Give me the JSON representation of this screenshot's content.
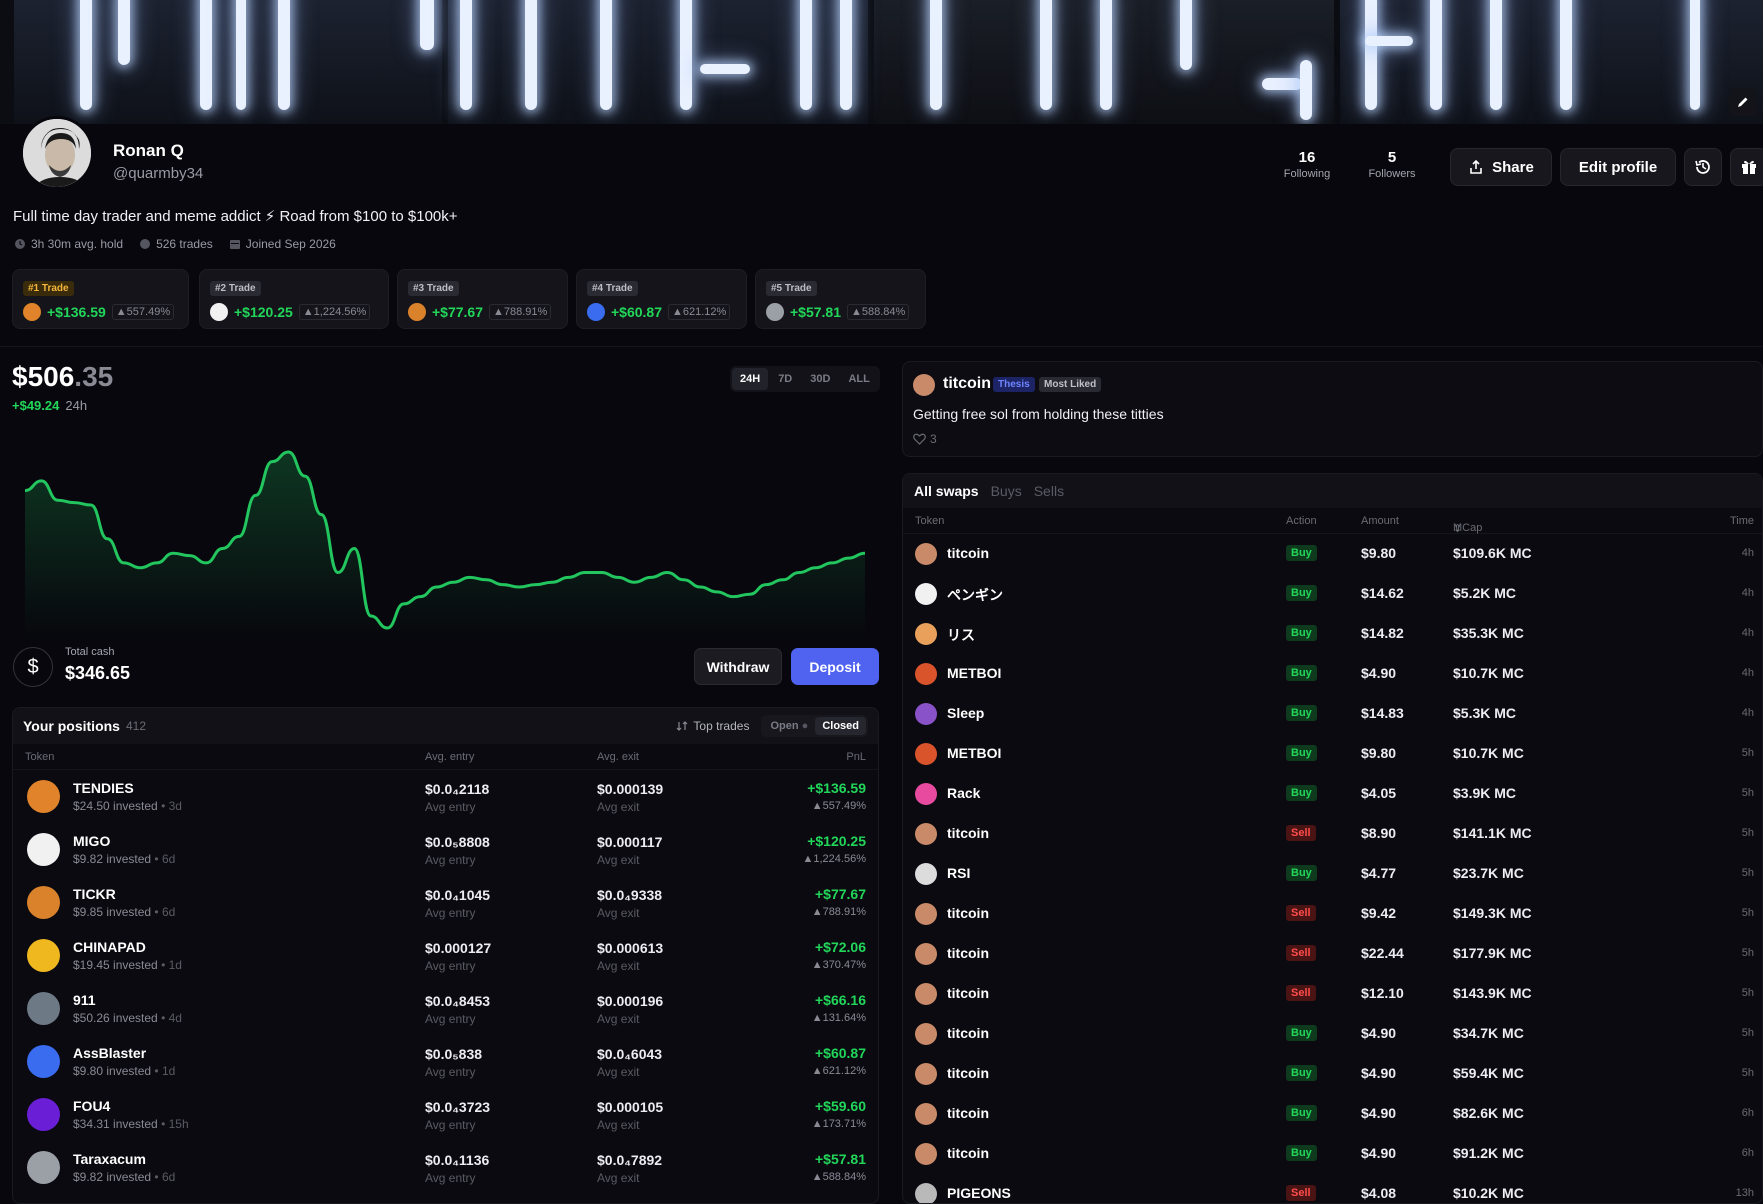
{
  "profile": {
    "name": "Ronan Q",
    "handle": "@quarmby34",
    "following_count": "16",
    "following_label": "Following",
    "followers_count": "5",
    "followers_label": "Followers",
    "share_label": "Share",
    "edit_label": "Edit profile",
    "bio": "Full time day trader and meme addict ⚡ Road from $100 to $100k+",
    "avg_hold": "3h 30m avg. hold",
    "trades": "526 trades",
    "joined": "Joined Sep 2026"
  },
  "top_trades": [
    {
      "rank": "#1 Trade",
      "value": "+$136.59",
      "pct": "▲557.49%",
      "icon_color": "#e0832a"
    },
    {
      "rank": "#2 Trade",
      "value": "+$120.25",
      "pct": "▲1,224.56%",
      "icon_color": "#f1f1f1"
    },
    {
      "rank": "#3 Trade",
      "value": "+$77.67",
      "pct": "▲788.91%",
      "icon_color": "#d9822b"
    },
    {
      "rank": "#4 Trade",
      "value": "+$60.87",
      "pct": "▲621.12%",
      "icon_color": "#3a6cf0"
    },
    {
      "rank": "#5 Trade",
      "value": "+$57.81",
      "pct": "▲588.84%",
      "icon_color": "#9aa0a6"
    }
  ],
  "balance": {
    "dollars": "$506",
    "cents": ".35",
    "change": "+$49.24",
    "period": "24h",
    "ranges": [
      "24H",
      "7D",
      "30D",
      "ALL"
    ],
    "active_range": "24H"
  },
  "chart_data": {
    "type": "area",
    "series": [
      {
        "values": [
          92,
          96,
          88,
          87,
          86,
          72,
          62,
          60,
          62,
          66,
          65,
          62,
          68,
          73,
          90,
          104,
          108,
          98,
          82,
          58,
          68,
          40,
          35,
          45,
          48,
          52,
          54,
          56,
          55,
          53,
          52,
          53,
          54,
          56,
          58,
          58,
          56,
          54,
          56,
          58,
          55,
          52,
          50,
          48,
          49,
          53,
          55,
          58,
          60,
          62,
          64,
          66
        ]
      }
    ],
    "color": "#22c55e"
  },
  "cash": {
    "label": "Total cash",
    "value": "$346.65",
    "withdraw_label": "Withdraw",
    "deposit_label": "Deposit"
  },
  "positions": {
    "title": "Your positions",
    "count": "412",
    "top_trades_label": "Top trades",
    "open_label": "Open",
    "closed_label": "Closed",
    "col_token": "Token",
    "col_entry": "Avg. entry",
    "col_exit": "Avg. exit",
    "col_pnl": "PnL",
    "sub_entry": "Avg entry",
    "sub_exit": "Avg exit",
    "rows": [
      {
        "name": "TENDIES",
        "invested": "$24.50 invested",
        "age": "• 3d",
        "entry": "$0.0₄2118",
        "exit": "$0.000139",
        "pnl": "+$136.59",
        "pct": "▲557.49%",
        "color": "#e0832a"
      },
      {
        "name": "MIGO",
        "invested": "$9.82 invested",
        "age": "• 6d",
        "entry": "$0.0₅8808",
        "exit": "$0.000117",
        "pnl": "+$120.25",
        "pct": "▲1,224.56%",
        "color": "#f1f1f1"
      },
      {
        "name": "TICKR",
        "invested": "$9.85 invested",
        "age": "• 6d",
        "entry": "$0.0₄1045",
        "exit": "$0.0₄9338",
        "pnl": "+$77.67",
        "pct": "▲788.91%",
        "color": "#d9822b"
      },
      {
        "name": "CHINAPAD",
        "invested": "$19.45 invested",
        "age": "• 1d",
        "entry": "$0.000127",
        "exit": "$0.000613",
        "pnl": "+$72.06",
        "pct": "▲370.47%",
        "color": "#f0b81f"
      },
      {
        "name": "911",
        "invested": "$50.26 invested",
        "age": "• 4d",
        "entry": "$0.0₄8453",
        "exit": "$0.000196",
        "pnl": "+$66.16",
        "pct": "▲131.64%",
        "color": "#6d7a86"
      },
      {
        "name": "AssBlaster",
        "invested": "$9.80 invested",
        "age": "• 1d",
        "entry": "$0.0₅838",
        "exit": "$0.0₄6043",
        "pnl": "+$60.87",
        "pct": "▲621.12%",
        "color": "#3a6cf0"
      },
      {
        "name": "FOU4",
        "invested": "$34.31 invested",
        "age": "• 15h",
        "entry": "$0.0₄3723",
        "exit": "$0.000105",
        "pnl": "+$59.60",
        "pct": "▲173.71%",
        "color": "#6a1fd6"
      },
      {
        "name": "Taraxacum",
        "invested": "$9.82 invested",
        "age": "• 6d",
        "entry": "$0.0₄1136",
        "exit": "$0.0₄7892",
        "pnl": "+$57.81",
        "pct": "▲588.84%",
        "color": "#9aa0a6"
      }
    ]
  },
  "thesis": {
    "token": "titcoin",
    "tag1": "Thesis",
    "tag2": "Most Liked",
    "text": "Getting free sol from holding these titties",
    "likes": "3"
  },
  "swaps": {
    "tabs": [
      "All swaps",
      "Buys",
      "Sells"
    ],
    "col_token": "Token",
    "col_action": "Action",
    "col_amount": "Amount",
    "col_mcap": "MCap",
    "col_time": "Time",
    "rows": [
      {
        "token": "titcoin",
        "action": "Buy",
        "amount": "$9.80",
        "mcap": "$109.6K MC",
        "time": "4h",
        "color": "#c98a6a"
      },
      {
        "token": "ペンギン",
        "action": "Buy",
        "amount": "$14.62",
        "mcap": "$5.2K MC",
        "time": "4h",
        "color": "#f1f1f1"
      },
      {
        "token": "リス",
        "action": "Buy",
        "amount": "$14.82",
        "mcap": "$35.3K MC",
        "time": "4h",
        "color": "#e8a05a"
      },
      {
        "token": "METBOI",
        "action": "Buy",
        "amount": "$4.90",
        "mcap": "$10.7K MC",
        "time": "4h",
        "color": "#d9542b"
      },
      {
        "token": "Sleep",
        "action": "Buy",
        "amount": "$14.83",
        "mcap": "$5.3K MC",
        "time": "4h",
        "color": "#8a52c8"
      },
      {
        "token": "METBOI",
        "action": "Buy",
        "amount": "$9.80",
        "mcap": "$10.7K MC",
        "time": "5h",
        "color": "#d9542b"
      },
      {
        "token": "Rack",
        "action": "Buy",
        "amount": "$4.05",
        "mcap": "$3.9K MC",
        "time": "5h",
        "color": "#e84aa0"
      },
      {
        "token": "titcoin",
        "action": "Sell",
        "amount": "$8.90",
        "mcap": "$141.1K MC",
        "time": "5h",
        "color": "#c98a6a"
      },
      {
        "token": "RSI",
        "action": "Buy",
        "amount": "$4.77",
        "mcap": "$23.7K MC",
        "time": "5h",
        "color": "#dcdcdc"
      },
      {
        "token": "titcoin",
        "action": "Sell",
        "amount": "$9.42",
        "mcap": "$149.3K MC",
        "time": "5h",
        "color": "#c98a6a"
      },
      {
        "token": "titcoin",
        "action": "Sell",
        "amount": "$22.44",
        "mcap": "$177.9K MC",
        "time": "5h",
        "color": "#c98a6a"
      },
      {
        "token": "titcoin",
        "action": "Sell",
        "amount": "$12.10",
        "mcap": "$143.9K MC",
        "time": "5h",
        "color": "#c98a6a"
      },
      {
        "token": "titcoin",
        "action": "Buy",
        "amount": "$4.90",
        "mcap": "$34.7K MC",
        "time": "5h",
        "color": "#c98a6a"
      },
      {
        "token": "titcoin",
        "action": "Buy",
        "amount": "$4.90",
        "mcap": "$59.4K MC",
        "time": "5h",
        "color": "#c98a6a"
      },
      {
        "token": "titcoin",
        "action": "Buy",
        "amount": "$4.90",
        "mcap": "$82.6K MC",
        "time": "6h",
        "color": "#c98a6a"
      },
      {
        "token": "titcoin",
        "action": "Buy",
        "amount": "$4.90",
        "mcap": "$91.2K MC",
        "time": "6h",
        "color": "#c98a6a"
      },
      {
        "token": "PIGEONS",
        "action": "Sell",
        "amount": "$4.08",
        "mcap": "$10.2K MC",
        "time": "13h",
        "color": "#b9b9b9"
      }
    ]
  }
}
